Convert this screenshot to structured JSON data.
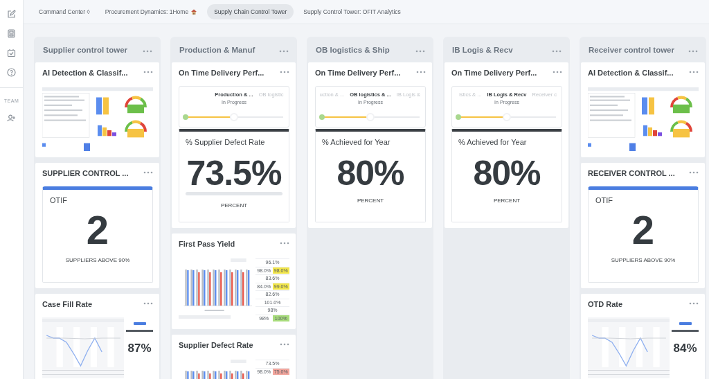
{
  "sidebar": {
    "section": "TEAM"
  },
  "tabs": [
    {
      "label": "Command Center ◊",
      "selected": false,
      "kind": "plain"
    },
    {
      "label": "Procurement Dynamics: 1Home",
      "selected": false,
      "kind": "home"
    },
    {
      "label": "Supply Chain Control Tower",
      "selected": true,
      "kind": "plain"
    },
    {
      "label": "Supply Control Tower: OFIT Analytics",
      "selected": false,
      "kind": "plain"
    }
  ],
  "columns": [
    {
      "title": "Supplier control tower",
      "cards": [
        {
          "kind": "dashboard-preview",
          "title": "AI Detection & Classif..."
        },
        {
          "kind": "count",
          "title": "SUPPLIER CONTROL ...",
          "box_title": "OTIF",
          "value": "2",
          "caption": "SUPPLIERS ABOVE 90%"
        },
        {
          "kind": "line-preview",
          "title": "Case Fill Rate",
          "value": "87%"
        }
      ]
    },
    {
      "title": "Production & Manuf",
      "cards": [
        {
          "kind": "progress",
          "title": "On Time Delivery Perf...",
          "steps": [
            {
              "label": "Production & ...",
              "selected": true,
              "status": "In Progress"
            },
            {
              "label": "OB logistic",
              "selected": false
            }
          ],
          "level": 0.5,
          "metric_title": "% Supplier Defect Rate",
          "value": "73.5%",
          "underline": true,
          "caption": "PERCENT"
        },
        {
          "kind": "bar-preview",
          "title": "First Pass Yield",
          "kpi_rows": [
            [
              {
                "value": "96.1%"
              }
            ],
            [
              {
                "value": "98.0%"
              },
              {
                "value": "98.0%",
                "color": "#f2e64a"
              }
            ],
            [
              {
                "value": "83.6%"
              }
            ],
            [
              {
                "value": "84.0%"
              },
              {
                "value": "99.0%",
                "color": "#f2e64a"
              }
            ],
            [
              {
                "value": "82.6%"
              }
            ],
            [
              {
                "value": "101.0%"
              }
            ],
            [
              {
                "value": "98%"
              }
            ],
            [
              {
                "value": "98%"
              },
              {
                "value": "100%",
                "color": "#a8dc7c"
              }
            ]
          ]
        },
        {
          "kind": "bar-preview",
          "title": "Supplier Defect Rate",
          "kpi_rows": [
            [
              {
                "value": "73.5%"
              }
            ],
            [
              {
                "value": "98.0%"
              },
              {
                "value": "75.0%",
                "color": "#f2a59c"
              }
            ]
          ]
        }
      ]
    },
    {
      "title": "OB logistics & Ship",
      "cards": [
        {
          "kind": "progress",
          "title": "On Time Delivery Perf...",
          "steps": [
            {
              "label": "uction & ...",
              "selected": false
            },
            {
              "label": "OB logistics & ...",
              "selected": true,
              "status": "In Progress"
            },
            {
              "label": "IB Logis &",
              "selected": false
            }
          ],
          "level": 0.5,
          "metric_title": "% Achieved for Year",
          "value": "80%",
          "underline": false,
          "caption": "PERCENT"
        }
      ]
    },
    {
      "title": "IB Logis & Recv",
      "cards": [
        {
          "kind": "progress",
          "title": "On Time Delivery Perf...",
          "steps": [
            {
              "label": "istics & ...",
              "selected": false
            },
            {
              "label": "IB Logis & Recv",
              "selected": true,
              "status": "In Progress"
            },
            {
              "label": "Receiver c",
              "selected": false
            }
          ],
          "level": 0.5,
          "metric_title": "% Achieved for Year",
          "value": "80%",
          "underline": false,
          "caption": "PERCENT"
        }
      ]
    },
    {
      "title": "Receiver control tower",
      "cards": [
        {
          "kind": "dashboard-preview",
          "title": "AI Detection & Classif..."
        },
        {
          "kind": "count",
          "title": "RECEIVER CONTROL ...",
          "box_title": "OTIF",
          "value": "2",
          "caption": "SUPPLIERS ABOVE 90%"
        },
        {
          "kind": "line-preview",
          "title": "OTD Rate",
          "value": "84%"
        }
      ]
    }
  ]
}
